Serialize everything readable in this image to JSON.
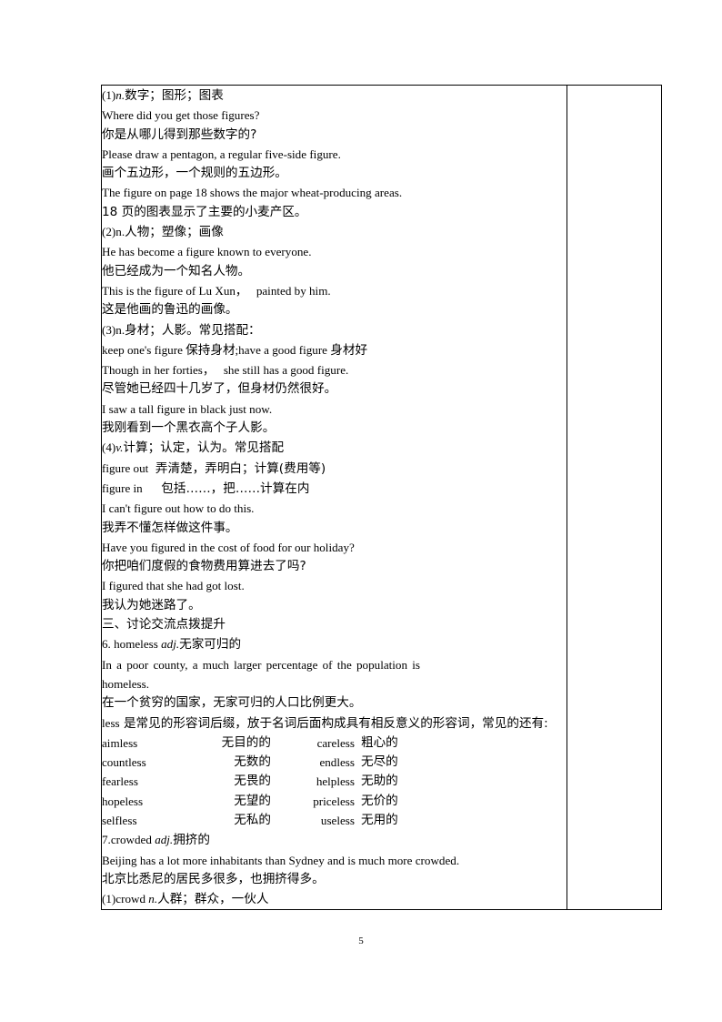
{
  "document": {
    "page_number": "5",
    "table": {
      "column_count": 2,
      "side_column_empty": true
    }
  },
  "content": {
    "entry_figure": {
      "sense1": {
        "label": "(1)",
        "pos": "n.",
        "gloss_cn": "数字；图形；图表",
        "examples": [
          {
            "en": "Where did you get those figures?",
            "cn": "你是从哪儿得到那些数字的?"
          },
          {
            "en": "Please draw a pentagon, a regular five-side figure.",
            "cn": "画个五边形，一个规则的五边形。"
          },
          {
            "en": "The figure on page 18 shows the major wheat-producing areas.",
            "cn": "18 页的图表显示了主要的小麦产区。"
          }
        ]
      },
      "sense2": {
        "label": "(2)",
        "pos": "n.",
        "gloss_cn": "人物；塑像；画像",
        "examples": [
          {
            "en": "He has become a figure known to everyone.",
            "cn": "他已经成为一个知名人物。"
          },
          {
            "en": "This is the figure of Lu Xun，   painted by him.",
            "cn": "这是他画的鲁迅的画像。"
          }
        ]
      },
      "sense3": {
        "label": "(3)",
        "pos": "n.",
        "gloss_cn": "身材；人影。常见搭配：",
        "collocation_en": "keep one's figure ",
        "collocation_cn": "保持身材",
        "collocation2_en": ";have a good figure ",
        "collocation2_cn": "身材好",
        "examples": [
          {
            "en": "Though in her forties，   she still has a good figure.",
            "cn": "尽管她已经四十几岁了，但身材仍然很好。"
          },
          {
            "en": "I saw a tall figure in black just now.",
            "cn": "我刚看到一个黑衣高个子人影。"
          }
        ]
      },
      "sense4": {
        "label": "(4)",
        "pos": "v.",
        "gloss_cn": "计算；认定，认为。常见搭配",
        "phrases": [
          {
            "en": "figure out ",
            "cn": " 弄清楚，弄明白；计算(费用等)"
          },
          {
            "en": "figure in ",
            "cn": "    包括……，把……计算在内"
          }
        ],
        "examples": [
          {
            "en": "I can't figure out how to do this.",
            "cn": "我弄不懂怎样做这件事。"
          },
          {
            "en": "Have you figured in the cost of food for our holiday?",
            "cn": "你把咱们度假的食物费用算进去了吗?"
          },
          {
            "en": "I figured that she had got lost.",
            "cn": "我认为她迷路了。"
          }
        ]
      }
    },
    "section_heading": "三、讨论交流点拨提升",
    "entry_homeless": {
      "number": "6. ",
      "word": "homeless ",
      "pos": "adj.",
      "gloss_cn": "无家可归的",
      "example_en": "In a poor county, a much larger percentage of the population is homeless.",
      "example_cn": "在一个贫穷的国家，无家可归的人口比例更大。",
      "note_prefix_en": "less",
      "note_cn": " 是常见的形容词后缀，放于名词后面构成具有相反意义的形容词，常见的还有:",
      "word_list": [
        {
          "en1": "aimless",
          "cn1": "无目的的",
          "en2": "careless",
          "cn2": "粗心的"
        },
        {
          "en1": "countless",
          "cn1": "无数的",
          "en2": "endless",
          "cn2": "无尽的"
        },
        {
          "en1": "fearless",
          "cn1": "无畏的",
          "en2": "helpless",
          "cn2": "无助的"
        },
        {
          "en1": "hopeless",
          "cn1": "无望的",
          "en2": "priceless",
          "cn2": "无价的"
        },
        {
          "en1": "selfless",
          "cn1": "无私的",
          "en2": "useless",
          "cn2": "无用的"
        }
      ]
    },
    "entry_crowded": {
      "number": "7.",
      "word": "crowded ",
      "pos": "adj.",
      "gloss_cn": "拥挤的",
      "example_en": "Beijing has a lot more inhabitants than Sydney and is much more crowded.",
      "example_cn": "北京比悉尼的居民多很多，也拥挤得多。",
      "sub1_label": "(1)",
      "sub1_word": "crowd ",
      "sub1_pos": "n.",
      "sub1_gloss_cn": "人群；群众，一伙人"
    }
  }
}
